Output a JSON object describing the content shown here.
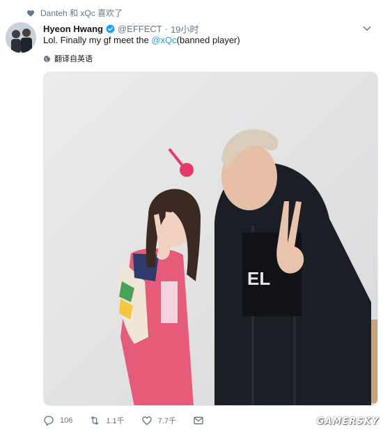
{
  "liked_by": {
    "icon": "heart-icon",
    "text": "Danteh 和 xQc 喜欢了"
  },
  "tweet": {
    "display_name": "Hyeon Hwang",
    "verified_icon": "verified-badge-icon",
    "handle": "@EFFECT",
    "separator": "·",
    "time": "19小时",
    "text_before": "Lol. Finally my gf meet the ",
    "mention": "@xQc",
    "text_after": "(banned player)",
    "translate_label": "翻译自英语"
  },
  "actions": {
    "reply_count": "106",
    "retweet_count": "1.1千",
    "like_count": "7.7千"
  },
  "watermark": "GAMERSKY",
  "colors": {
    "link": "#1da1f2",
    "muted": "#657786",
    "text": "#14171a"
  }
}
